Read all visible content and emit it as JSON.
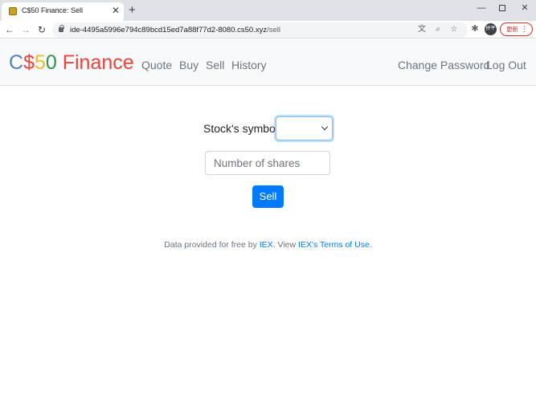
{
  "browser": {
    "tab_title": "C$50 Finance: Sell",
    "new_tab_symbol": "+",
    "url_host": "ide-4495a5996e794c89bcd15ed7a88f77d2-8080.cs50.xyz",
    "url_path": "/sell",
    "profile_initials": "拼平",
    "update_label": "更新",
    "icons": [
      "favicon-icon",
      "close-icon",
      "new-tab-icon",
      "minimize-icon",
      "maximize-icon",
      "window-close-icon",
      "back-icon",
      "forward-icon",
      "reload-icon",
      "lock-icon",
      "translate-icon",
      "zoom-icon",
      "star-icon",
      "extensions-icon",
      "kebab-menu-icon"
    ]
  },
  "navbar": {
    "brand": {
      "c": "C",
      "dollar": "$",
      "five": "5",
      "zero": "0",
      "word": " Finance"
    },
    "links": {
      "quote": "Quote",
      "buy": "Buy",
      "sell": "Sell",
      "history": "History"
    },
    "right_links": {
      "change_password": "Change Password",
      "logout": "Log Out"
    }
  },
  "form": {
    "symbol_label": "Stock's symbol :",
    "symbol_selected": "",
    "shares_placeholder": "Number of shares",
    "sell_label": "Sell"
  },
  "footer": {
    "prefix": "Data provided for free by ",
    "iex_link": "IEX",
    "middle": ". View ",
    "terms_link": "IEX's Terms of Use",
    "suffix": "."
  },
  "colors": {
    "brand_blue": "#537fbe",
    "brand_red": "#ea433b",
    "brand_yellow": "#f5b82e",
    "brand_green": "#2e944b",
    "primary": "#007bff"
  }
}
